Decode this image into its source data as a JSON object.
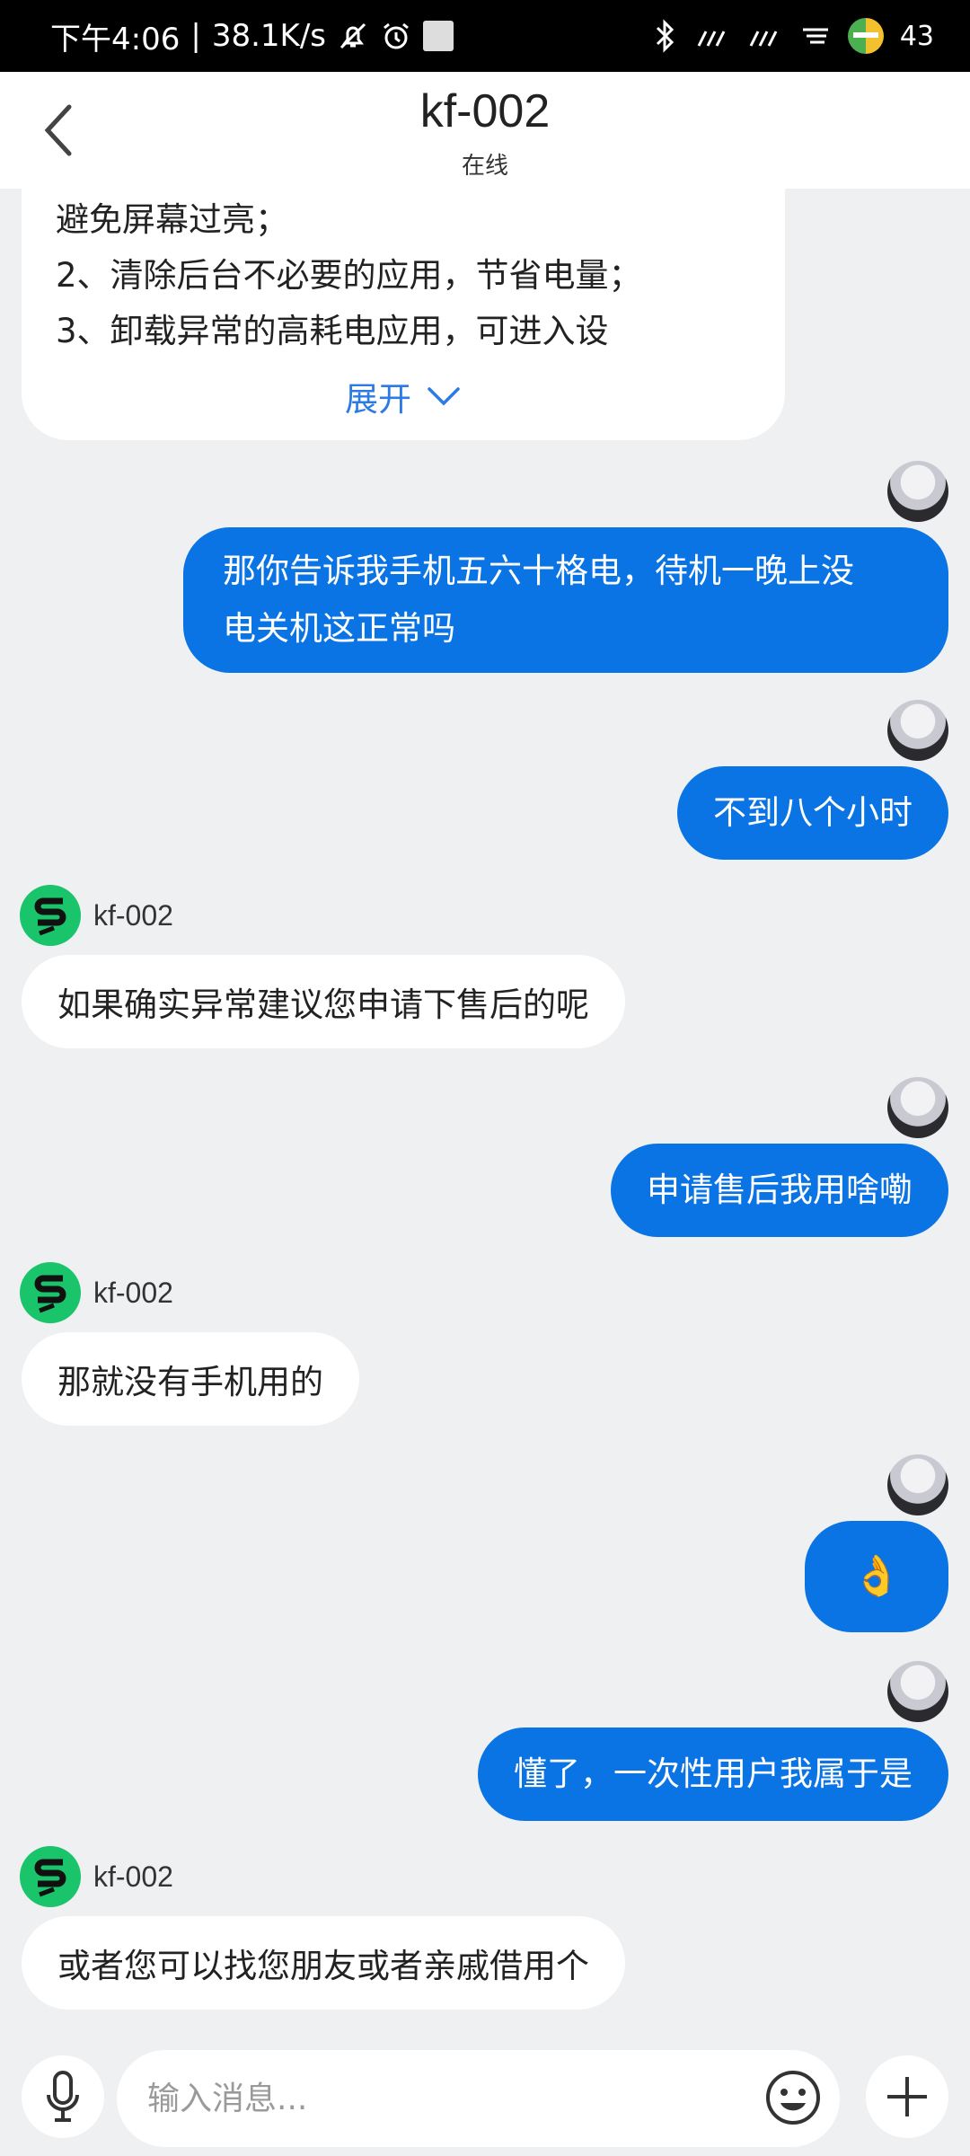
{
  "status_bar": {
    "time": "下午4:06",
    "separator": "|",
    "net_speed": "38.1K/s",
    "battery": "43",
    "icons": [
      "mute-bell-icon",
      "alarm-icon",
      "image-icon",
      "bluetooth-icon",
      "signal-icon",
      "signal-icon",
      "wifi-icon",
      "battery-icon"
    ]
  },
  "header": {
    "title": "kf-002",
    "subtitle": "在线",
    "back_icon": "chevron-left-icon"
  },
  "card": {
    "partial_line": "避免屏幕过亮；",
    "line2": "2、清除后台不必要的应用，节省电量；",
    "line3": "3、卸载异常的高耗电应用，可进入设",
    "expand_label": "展开"
  },
  "agent": {
    "name": "kf-002",
    "logo_color": "#19c46b"
  },
  "messages": [
    {
      "from": "user",
      "lines": [
        "那你告诉我手机五六十格电，待机一晚上没",
        "电关机这正常吗"
      ]
    },
    {
      "from": "user",
      "text": "不到八个小时"
    },
    {
      "from": "agent",
      "text": "如果确实异常建议您申请下售后的呢"
    },
    {
      "from": "user",
      "text": "申请售后我用啥嘞"
    },
    {
      "from": "agent",
      "text": "那就没有手机用的"
    },
    {
      "from": "user",
      "text": "👌"
    },
    {
      "from": "user",
      "text": "懂了，一次性用户我属于是"
    },
    {
      "from": "agent",
      "text": "或者您可以找您朋友或者亲戚借用个"
    }
  ],
  "input_bar": {
    "placeholder": "输入消息...",
    "mic_icon": "microphone-icon",
    "emoji_icon": "emoji-icon",
    "plus_icon": "plus-icon"
  },
  "colors": {
    "user_bubble": "#0b74e4",
    "background": "#eff0f2",
    "link": "#2c7be5"
  }
}
